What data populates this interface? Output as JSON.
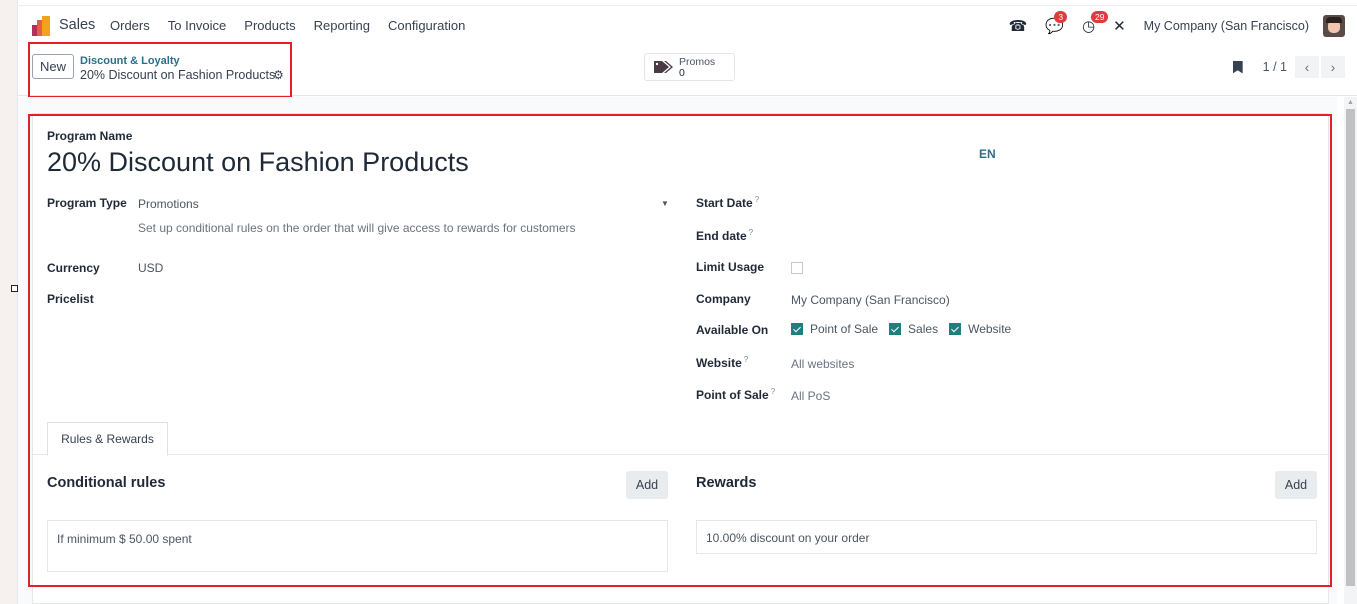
{
  "navbar": {
    "app_name": "Sales",
    "menu": [
      "Orders",
      "To Invoice",
      "Products",
      "Reporting",
      "Configuration"
    ],
    "systray": {
      "phone_icon": "phone-icon",
      "messages_count": "3",
      "activities_count": "29",
      "debug_icon": "tools-icon",
      "company": "My Company (San Francisco)"
    }
  },
  "control_panel": {
    "new_label": "New",
    "breadcrumb_parent": "Discount & Loyalty",
    "breadcrumb_current": "20% Discount on Fashion Products",
    "smart_button": {
      "label": "Promos",
      "value": "0"
    },
    "pager": {
      "value": "1 / 1",
      "prev": "‹",
      "next": "›"
    }
  },
  "form": {
    "program_name_label": "Program Name",
    "program_name": "20% Discount on Fashion Products",
    "lang": "EN",
    "left": {
      "program_type_label": "Program Type",
      "program_type": "Promotions",
      "program_type_help": "Set up conditional rules on the order that will give access to rewards for customers",
      "currency_label": "Currency",
      "currency": "USD",
      "pricelist_label": "Pricelist"
    },
    "right": {
      "start_date_label": "Start Date",
      "end_date_label": "End date",
      "limit_usage_label": "Limit Usage",
      "limit_usage": false,
      "company_label": "Company",
      "company": "My Company (San Francisco)",
      "available_on_label": "Available On",
      "available_on": [
        {
          "label": "Point of Sale",
          "checked": true
        },
        {
          "label": "Sales",
          "checked": true
        },
        {
          "label": "Website",
          "checked": true
        }
      ],
      "website_label": "Website",
      "website": "All websites",
      "pos_label": "Point of Sale",
      "pos": "All PoS",
      "help_mark": "?"
    },
    "tabs": [
      "Rules & Rewards"
    ],
    "rules": {
      "title": "Conditional rules",
      "add_label": "Add",
      "items": [
        "If minimum $ 50.00 spent"
      ]
    },
    "rewards": {
      "title": "Rewards",
      "add_label": "Add",
      "items": [
        "10.00% discount on your order"
      ]
    }
  },
  "colors": {
    "accent": "#2b6f8a",
    "checkbox": "#1f7f7f",
    "highlight": "#e0202a",
    "badge": "#e03a3e"
  }
}
